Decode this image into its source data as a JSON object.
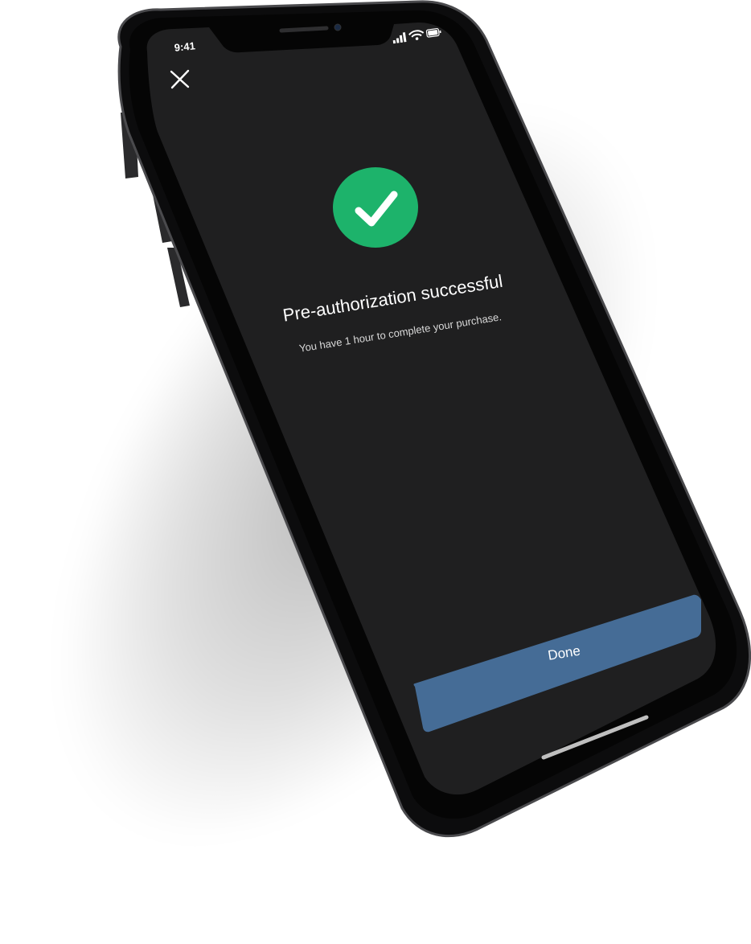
{
  "status_bar": {
    "time": "9:41",
    "icons": [
      "signal-icon",
      "wifi-icon",
      "battery-icon"
    ]
  },
  "header": {
    "close_icon": "close-icon"
  },
  "confirmation": {
    "icon": "checkmark-icon",
    "title": "Pre-authorization successful",
    "message": "You have 1 hour to complete your purchase."
  },
  "actions": {
    "done_label": "Done"
  },
  "colors": {
    "screen_background": "#1f1f20",
    "success_green": "#1db36b",
    "primary_button": "#456c96",
    "text_primary": "#ffffff",
    "text_secondary": "#d9d9d9"
  }
}
